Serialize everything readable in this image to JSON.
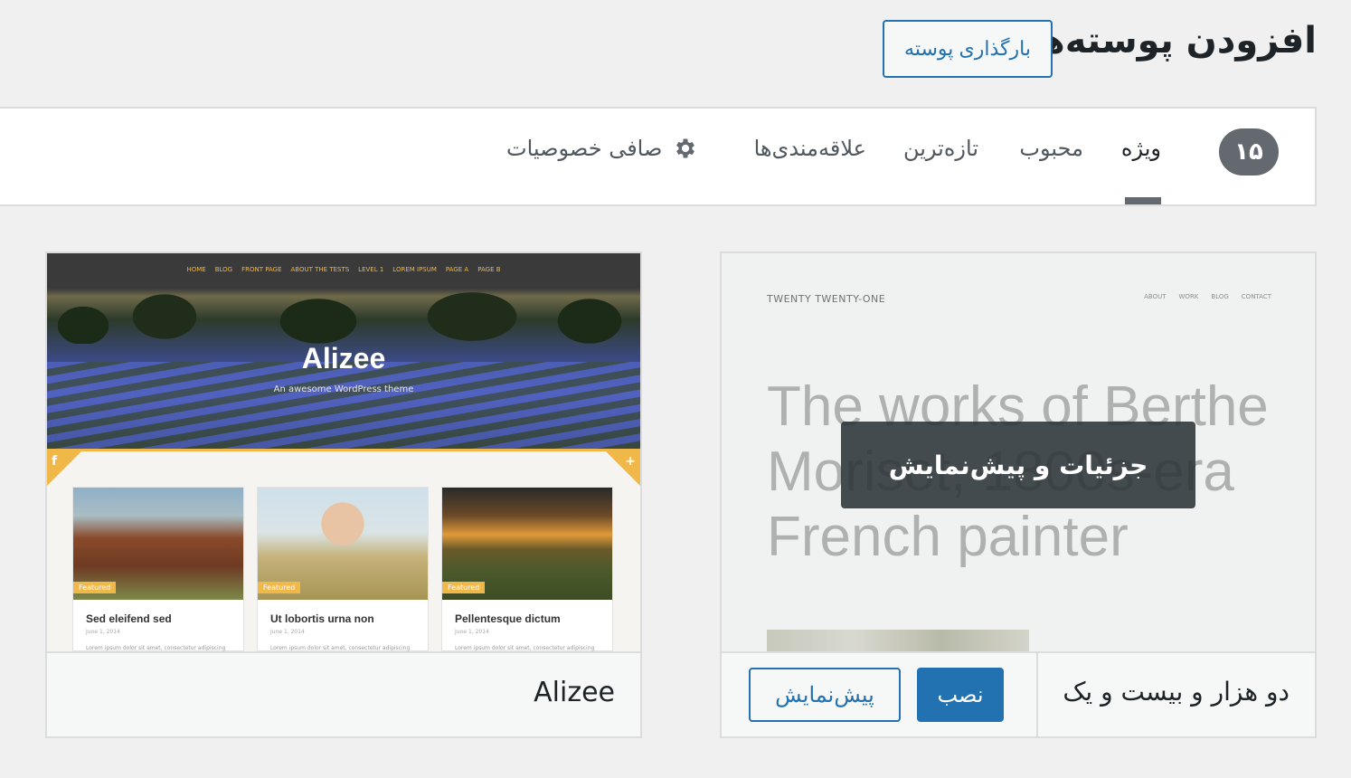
{
  "header": {
    "title": "افزودن پوسته‌ها",
    "upload_label": "بارگذاری پوسته"
  },
  "filters": {
    "count": "۱۵",
    "tabs": [
      {
        "label": "ویژه",
        "active": true
      },
      {
        "label": "محبوب",
        "active": false
      },
      {
        "label": "تازه‌ترین",
        "active": false
      },
      {
        "label": "علاقه‌مندی‌ها",
        "active": false
      }
    ],
    "feature_filter_label": "صافی خصوصیات",
    "feature_filter_icon": "gear-icon"
  },
  "themes": [
    {
      "name": "Alizee",
      "screenshot": {
        "nav": [
          "HOME",
          "BLOG",
          "FRONT PAGE",
          "ABOUT THE TESTS",
          "LEVEL 1",
          "LOREM IPSUM",
          "PAGE A",
          "PAGE B"
        ],
        "site_title": "Alizee",
        "tagline": "An awesome WordPress theme",
        "corner_left": "f",
        "corner_right": "+",
        "posts": [
          {
            "tag": "Featured",
            "title": "Sed eleifend sed",
            "date": "June 1, 2014",
            "excerpt": "Lorem ipsum dolor sit amet, consectetur adipiscing"
          },
          {
            "tag": "Featured",
            "title": "Ut lobortis urna non",
            "date": "June 1, 2014",
            "excerpt": "Lorem ipsum dolor sit amet, consectetur adipiscing"
          },
          {
            "tag": "Featured",
            "title": "Pellentesque dictum",
            "date": "June 1, 2014",
            "excerpt": "Lorem ipsum dolor sit amet, consectetur adipiscing"
          }
        ]
      }
    },
    {
      "name": "دو هزار و بیست و یک",
      "screenshot": {
        "site_title": "TWENTY TWENTY-ONE",
        "menu": [
          "ABOUT",
          "WORK",
          "BLOG",
          "CONTACT"
        ],
        "headline": "The works of Berthe Morisot, 1800s-era French painter"
      },
      "hover_label": "جزئیات و پیش‌نمایش",
      "install_label": "نصب",
      "preview_label": "پیش‌نمایش"
    }
  ],
  "colors": {
    "accent": "#2271b1",
    "badge": "#646970",
    "alizee_gold": "#f0b849"
  }
}
